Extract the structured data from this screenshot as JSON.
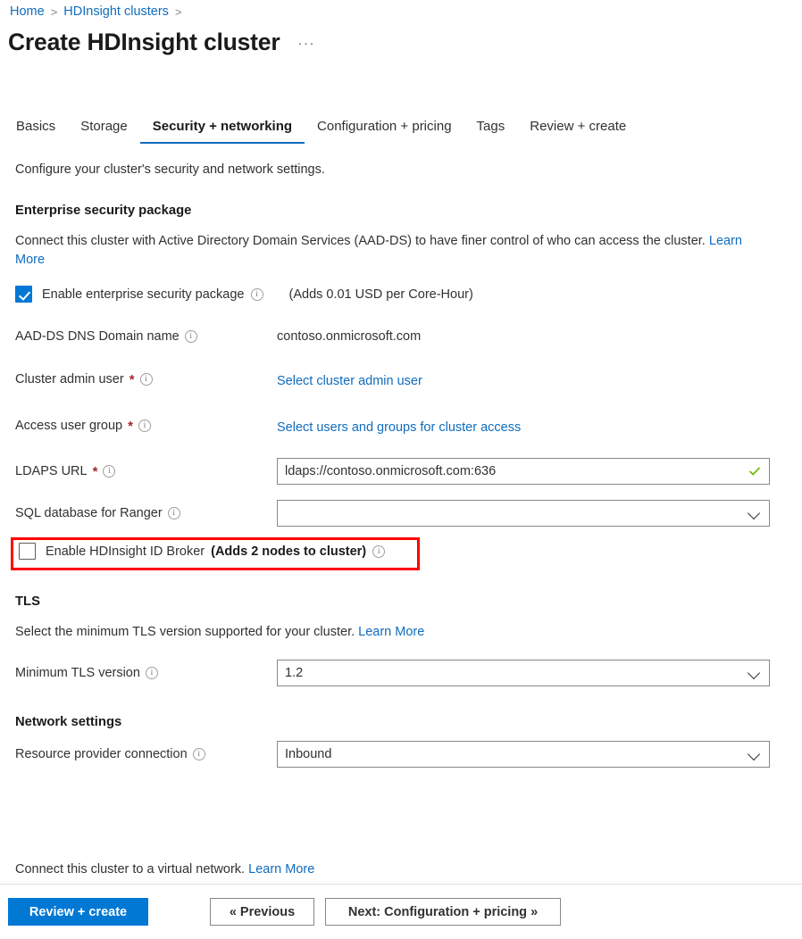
{
  "breadcrumb": {
    "items": [
      {
        "label": "Home"
      },
      {
        "label": "HDInsight clusters"
      }
    ],
    "separator": ">"
  },
  "header": {
    "title": "Create HDInsight cluster",
    "more_actions": "···"
  },
  "tabs": [
    {
      "label": "Basics",
      "active": false
    },
    {
      "label": "Storage",
      "active": false
    },
    {
      "label": "Security + networking",
      "active": true
    },
    {
      "label": "Configuration + pricing",
      "active": false
    },
    {
      "label": "Tags",
      "active": false
    },
    {
      "label": "Review + create",
      "active": false
    }
  ],
  "subtitle": "Configure your cluster's security and network settings.",
  "sections": {
    "esp": {
      "heading": "Enterprise security package",
      "description": "Connect this cluster with Active Directory Domain Services (AAD-DS) to have finer control of who can access the cluster.",
      "description_link": "Learn More",
      "enable_checkbox": {
        "label": "Enable enterprise security package",
        "checked": true,
        "note": "(Adds 0.01 USD per Core-Hour)"
      },
      "fields": {
        "dns_domain": {
          "label": "AAD-DS DNS Domain name",
          "value": "contoso.onmicrosoft.com",
          "required": false
        },
        "cluster_admin": {
          "label": "Cluster admin user",
          "value": "Select cluster admin user",
          "required": true
        },
        "access_group": {
          "label": "Access user group",
          "value": "Select users and groups for cluster access",
          "required": true
        },
        "ldaps_url": {
          "label": "LDAPS URL",
          "value": "ldaps://contoso.onmicrosoft.com:636",
          "required": true,
          "valid": true
        },
        "sql_ranger": {
          "label": "SQL database for Ranger",
          "value": "",
          "required": false
        }
      },
      "id_broker": {
        "label_normal": "Enable HDInsight ID Broker ",
        "label_bold": "(Adds 2 nodes to cluster)",
        "checked": false,
        "highlighted": true,
        "highlight_color": "#ff0000"
      }
    },
    "tls": {
      "heading": "TLS",
      "description": "Select the minimum TLS version supported for your cluster.",
      "description_link": "Learn More",
      "min_version": {
        "label": "Minimum TLS version",
        "value": "1.2"
      }
    },
    "network": {
      "heading": "Network settings",
      "rp_connection": {
        "label": "Resource provider connection",
        "value": "Inbound"
      }
    }
  },
  "footer": {
    "note": "Connect this cluster to a virtual network.",
    "note_link": "Learn More",
    "buttons": {
      "review_create": "Review + create",
      "previous": "« Previous",
      "next": "Next: Configuration + pricing »"
    }
  },
  "colors": {
    "accent": "#0078d4",
    "link": "#0f6cbd",
    "required": "#a4262c",
    "valid": "#6bb700",
    "highlight": "#ff0000"
  }
}
